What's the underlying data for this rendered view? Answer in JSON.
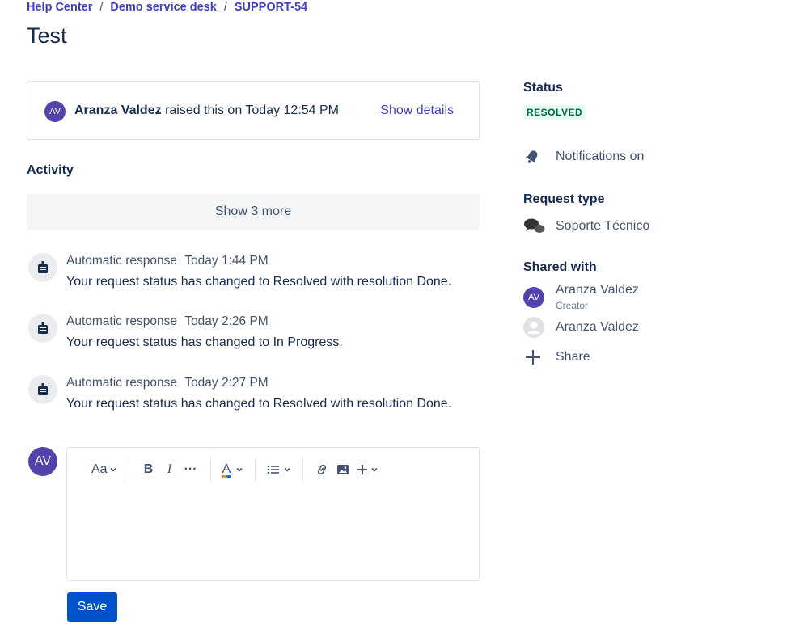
{
  "breadcrumb": {
    "items": [
      "Help Center",
      "Demo service desk",
      "SUPPORT-54"
    ],
    "separator": "/"
  },
  "page": {
    "title": "Test"
  },
  "summary": {
    "avatar_initials": "AV",
    "reporter": "Aranza Valdez",
    "raised_text": "raised this on Today 12:54 PM",
    "show_details": "Show details"
  },
  "activity": {
    "heading": "Activity",
    "show_more": "Show 3 more",
    "items": [
      {
        "author": "Automatic response",
        "time": "Today 1:44 PM",
        "message": "Your request status has changed to Resolved with resolution Done."
      },
      {
        "author": "Automatic response",
        "time": "Today 2:26 PM",
        "message": "Your request status has changed to In Progress."
      },
      {
        "author": "Automatic response",
        "time": "Today 2:27 PM",
        "message": "Your request status has changed to Resolved with resolution Done."
      }
    ]
  },
  "comment": {
    "avatar_initials": "AV",
    "toolbar": {
      "text_style": "Aa",
      "bold": "B",
      "italic": "I",
      "more": "···",
      "color": "A"
    },
    "save_label": "Save"
  },
  "sidebar": {
    "status_heading": "Status",
    "status_value": "RESOLVED",
    "notifications": "Notifications on",
    "request_type_heading": "Request type",
    "request_type": "Soporte Técnico",
    "shared_heading": "Shared with",
    "shared": [
      {
        "initials": "AV",
        "name": "Aranza Valdez",
        "role": "Creator"
      },
      {
        "initials": "",
        "name": "Aranza Valdez",
        "role": ""
      }
    ],
    "share_label": "Share"
  },
  "colors": {
    "link": "#3f3fbd",
    "avatar": "#5243aa",
    "primary_button": "#0052cc",
    "resolved_bg": "#e3fcef",
    "resolved_text": "#006644"
  }
}
